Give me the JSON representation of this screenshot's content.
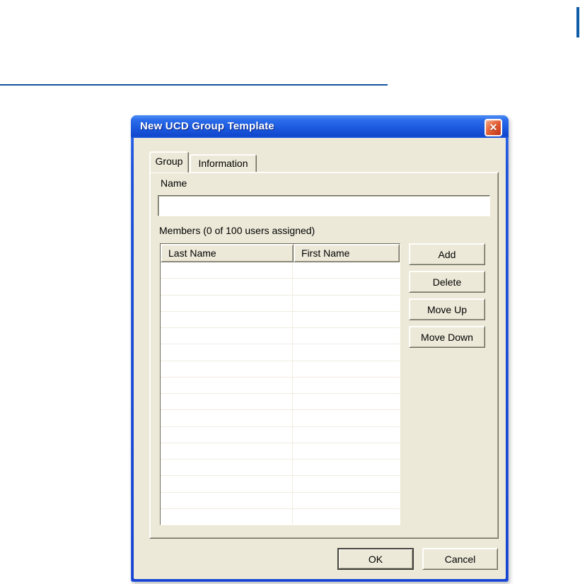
{
  "decor": {
    "top_rule_color": "#11519c",
    "edge_bar_color": "#0f5ca8"
  },
  "dialog": {
    "title": "New UCD Group Template",
    "icons": {
      "close": "✕"
    },
    "titlebar_color": "#1a57dd",
    "close_button_color": "#d64c26",
    "tabs": [
      {
        "label": "Group",
        "active": true
      },
      {
        "label": "Information",
        "active": false
      }
    ],
    "group_tab": {
      "name_label": "Name",
      "name_value": "",
      "members_label": "Members (0 of 100 users assigned)",
      "members_assigned": 0,
      "members_capacity": 100,
      "table": {
        "columns": [
          "Last Name",
          "First Name"
        ],
        "row_count": 16,
        "records": []
      },
      "action_buttons": [
        "Add",
        "Delete",
        "Move Up",
        "Move Down"
      ]
    },
    "footer": {
      "ok_label": "OK",
      "cancel_label": "Cancel"
    }
  }
}
